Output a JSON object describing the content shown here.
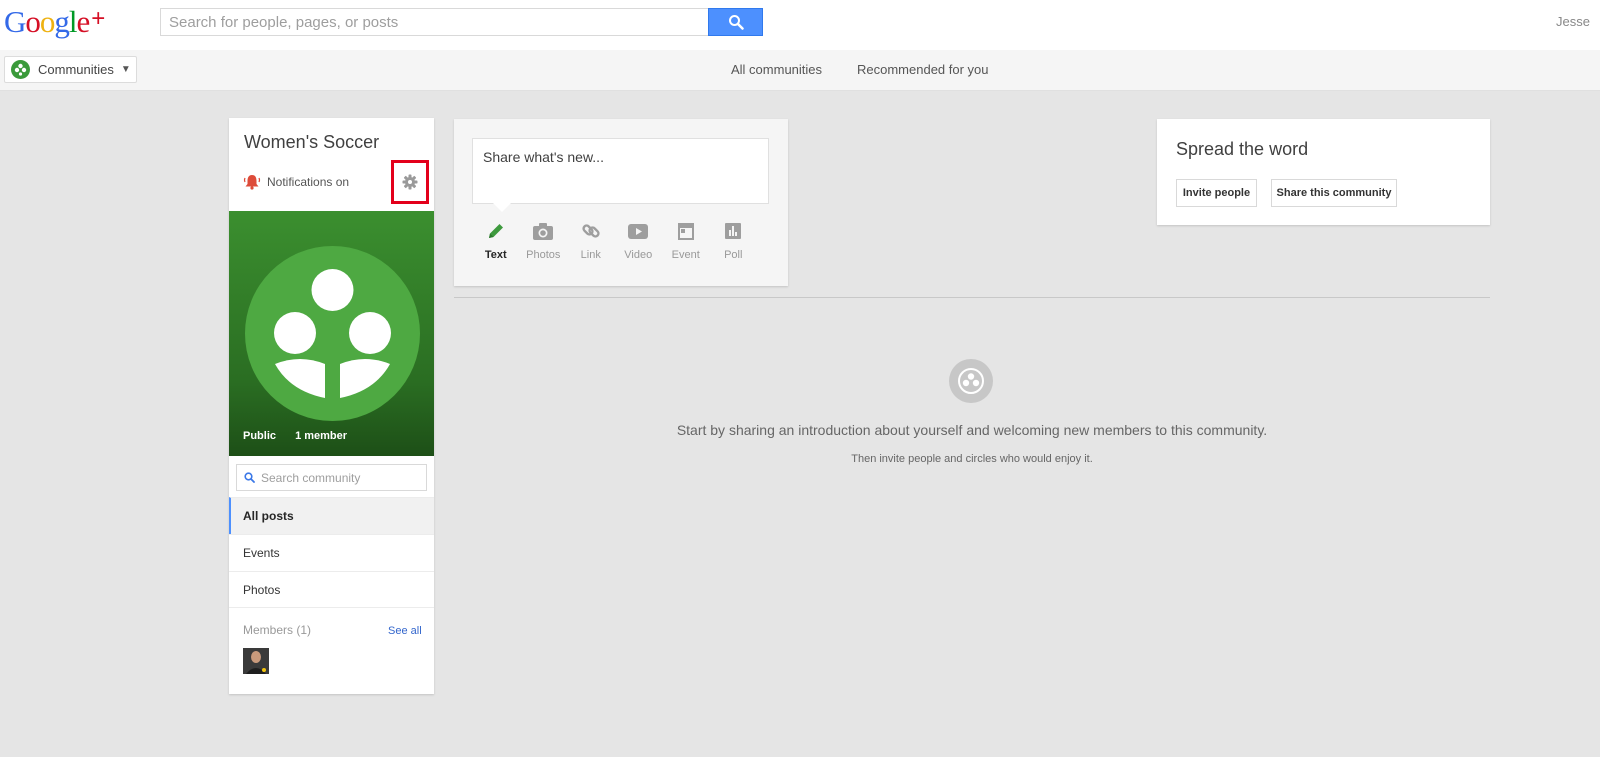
{
  "header": {
    "logo": {
      "letters": [
        "G",
        "o",
        "o",
        "g",
        "l",
        "e"
      ],
      "colors": [
        "#3369e8",
        "#d50f25",
        "#eeb211",
        "#3369e8",
        "#009925",
        "#d50f25"
      ],
      "plus": "+"
    },
    "search_placeholder": "Search for people, pages, or posts",
    "search_icon": "search-icon",
    "user_name": "Jesse"
  },
  "subnav": {
    "communities_label": "Communities",
    "links": [
      "All communities",
      "Recommended for you"
    ]
  },
  "community": {
    "title": "Women's Soccer",
    "notifications": "Notifications on",
    "visibility": "Public",
    "member_count": "1 member",
    "search_placeholder": "Search community",
    "nav": [
      "All posts",
      "Events",
      "Photos"
    ],
    "members_label": "Members (1)",
    "see_all": "See all"
  },
  "share": {
    "prompt": "Share what's new...",
    "actions": [
      {
        "label": "Text",
        "icon": "pencil-icon"
      },
      {
        "label": "Photos",
        "icon": "camera-icon"
      },
      {
        "label": "Link",
        "icon": "link-icon"
      },
      {
        "label": "Video",
        "icon": "video-icon"
      },
      {
        "label": "Event",
        "icon": "event-icon"
      },
      {
        "label": "Poll",
        "icon": "poll-icon"
      }
    ]
  },
  "empty_state": {
    "main": "Start by sharing an introduction about yourself and welcoming new members to this community.",
    "sub": "Then invite people and circles who would enjoy it."
  },
  "spread": {
    "title": "Spread the word",
    "invite": "Invite people",
    "share": "Share this community"
  },
  "colors": {
    "accent_blue": "#4d90fe",
    "highlight_red": "#e3001b",
    "community_green": "#3a9a3a",
    "bell_red": "#dd4b39"
  }
}
